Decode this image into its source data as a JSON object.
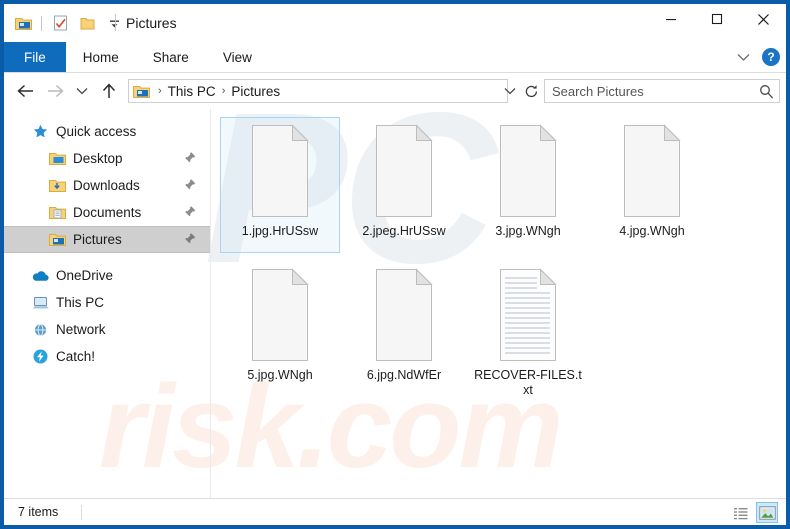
{
  "window": {
    "title": "Pictures",
    "accent_color": "#0a5ca8",
    "tab_active_color": "#0f6cbd",
    "minimize_label": "─",
    "maximize_label": "□",
    "close_label": "✕"
  },
  "quick_access_toolbar": {
    "items": [
      {
        "name": "pictures-folder-icon",
        "label": "Pictures"
      },
      {
        "name": "properties-icon",
        "label": "Properties"
      },
      {
        "name": "new-folder-icon",
        "label": "New folder"
      },
      {
        "name": "customize-dropdown-icon",
        "label": "Customize Quick Access Toolbar"
      }
    ]
  },
  "ribbon": {
    "tabs": [
      {
        "label": "File",
        "active": true
      },
      {
        "label": "Home",
        "active": false
      },
      {
        "label": "Share",
        "active": false
      },
      {
        "label": "View",
        "active": false
      }
    ],
    "expand_label": "⌄",
    "help_label": "?"
  },
  "address_bar": {
    "back_label": "←",
    "forward_label": "→",
    "recent_label": "⌄",
    "up_label": "↑",
    "breadcrumbs": [
      {
        "label": "This PC"
      },
      {
        "label": "Pictures"
      }
    ],
    "breadcrumb_separator": "›",
    "dropdown_label": "⌄",
    "refresh_label": "↻"
  },
  "search": {
    "placeholder": "Search Pictures",
    "value": ""
  },
  "sidebar": {
    "items": [
      {
        "label": "Quick access",
        "icon": "star-icon",
        "level": "top",
        "pinned": false,
        "selected": false
      },
      {
        "label": "Desktop",
        "icon": "desktop-folder-icon",
        "level": "child",
        "pinned": true,
        "selected": false
      },
      {
        "label": "Downloads",
        "icon": "downloads-folder-icon",
        "level": "child",
        "pinned": true,
        "selected": false
      },
      {
        "label": "Documents",
        "icon": "documents-folder-icon",
        "level": "child",
        "pinned": true,
        "selected": false
      },
      {
        "label": "Pictures",
        "icon": "pictures-folder-icon",
        "level": "child",
        "pinned": true,
        "selected": true
      },
      {
        "label": "OneDrive",
        "icon": "onedrive-cloud-icon",
        "level": "root",
        "pinned": false,
        "selected": false
      },
      {
        "label": "This PC",
        "icon": "this-pc-icon",
        "level": "root",
        "pinned": false,
        "selected": false
      },
      {
        "label": "Network",
        "icon": "network-icon",
        "level": "root",
        "pinned": false,
        "selected": false
      },
      {
        "label": "Catch!",
        "icon": "catch-app-icon",
        "level": "root",
        "pinned": false,
        "selected": false
      }
    ]
  },
  "files": [
    {
      "name": "1.jpg.HrUSsw",
      "icon": "blank-document-icon",
      "selected": true
    },
    {
      "name": "2.jpeg.HrUSsw",
      "icon": "blank-document-icon",
      "selected": false
    },
    {
      "name": "3.jpg.WNgh",
      "icon": "blank-document-icon",
      "selected": false
    },
    {
      "name": "4.jpg.WNgh",
      "icon": "blank-document-icon",
      "selected": false
    },
    {
      "name": "5.jpg.WNgh",
      "icon": "blank-document-icon",
      "selected": false
    },
    {
      "name": "6.jpg.NdWfEr",
      "icon": "blank-document-icon",
      "selected": false
    },
    {
      "name": "RECOVER-FILES.txt",
      "icon": "text-document-icon",
      "selected": false
    }
  ],
  "status_bar": {
    "item_count_text": "7 items",
    "views": [
      {
        "name": "details-view-button",
        "label": "Details view",
        "active": false
      },
      {
        "name": "large-icons-view-button",
        "label": "Large icons view",
        "active": true
      }
    ]
  },
  "watermarks": {
    "primary": "PC",
    "secondary": "risk.com"
  }
}
